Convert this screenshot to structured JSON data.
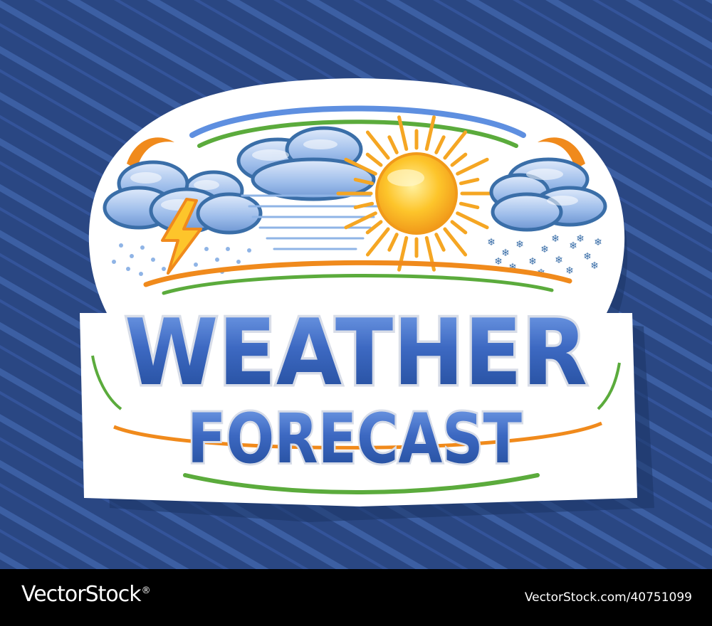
{
  "badge": {
    "title_line_1": "WEATHER",
    "title_line_2": "FORECAST",
    "icons": [
      "thunderstorm-cloud-icon",
      "windy-cloud-icon",
      "sun-icon",
      "snow-cloud-icon"
    ]
  },
  "footer": {
    "brand": "VectorStock",
    "brand_mark": "®",
    "stock_id": "VectorStock.com/40751099"
  },
  "colors": {
    "background": "#2a4783",
    "stripe": "#3c5fa3",
    "sticker": "#ffffff",
    "title_blue": "#2f5cb3",
    "title_light": "#6b98e6",
    "title_highlight": "#d8dde8",
    "accent_orange": "#f08a1c",
    "accent_green": "#5bab3c",
    "sun": "#fdc52b",
    "cloud": "#8fb4e6",
    "cloud_outline": "#3a6ea8",
    "footer": "#000000"
  }
}
